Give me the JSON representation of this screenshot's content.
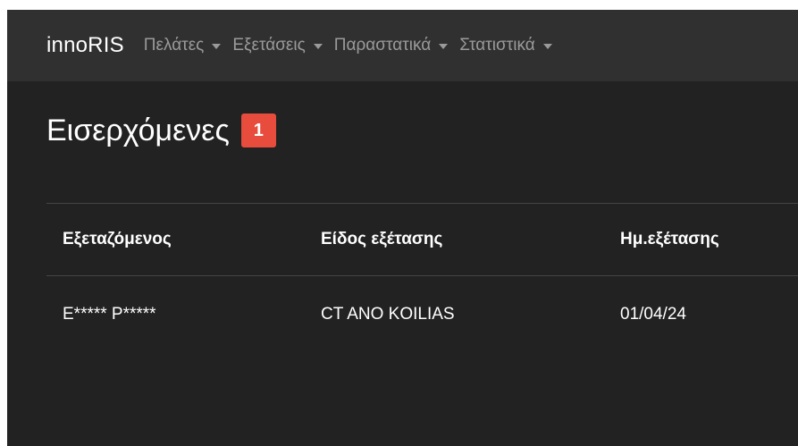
{
  "navbar": {
    "brand": "innoRIS",
    "items": [
      {
        "label": "Πελάτες"
      },
      {
        "label": "Εξετάσεις"
      },
      {
        "label": "Παραστατικά"
      },
      {
        "label": "Στατιστικά"
      }
    ]
  },
  "page": {
    "title": "Εισερχόμενες",
    "badge_count": "1"
  },
  "table": {
    "columns": [
      "Εξεταζόμενος",
      "Είδος εξέτασης",
      "Ημ.εξέτασης"
    ],
    "rows": [
      [
        "E***** P*****",
        "CT ANO KOILIAS",
        "01/04/24"
      ]
    ]
  },
  "colors": {
    "background": "#222222",
    "navbar": "#303030",
    "badge": "#e74c3c",
    "nav_text": "#9a9a9a"
  },
  "icons": [
    "caret-down-icon"
  ]
}
